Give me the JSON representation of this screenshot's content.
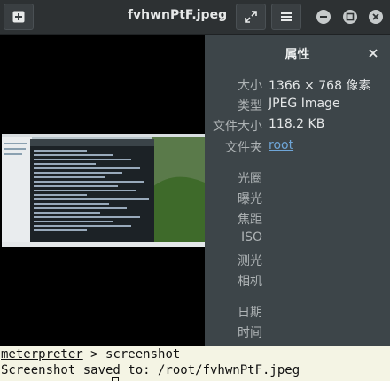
{
  "header": {
    "title": "fvhwnPtF.jpeg",
    "icons": [
      "add-icon",
      "fullscreen-icon",
      "menu-icon",
      "minimize-icon",
      "maximize-icon",
      "close-icon"
    ]
  },
  "properties": {
    "title": "属性",
    "size_label": "大小",
    "size_value": "1366 × 768 像素",
    "type_label": "类型",
    "type_value": "JPEG Image",
    "filesize_label": "文件大小",
    "filesize_value": "118.2 KB",
    "folder_label": "文件夹",
    "folder_value": "root",
    "exif": [
      "光圈",
      "曝光",
      "焦距",
      "ISO",
      "测光",
      "相机"
    ],
    "date_label": "日期",
    "time_label": "时间"
  },
  "terminal": {
    "prompt": "meterpreter",
    "prompt_sep": " > ",
    "command": "screenshot",
    "output_line": "Screenshot saved to: /root/fvhwnPtF.jpeg"
  },
  "colors": {
    "panel_bg": "#3d4549",
    "header_bg": "#2d3133",
    "link": "#6fa6d8",
    "terminal_bg": "#f4f4e4"
  }
}
